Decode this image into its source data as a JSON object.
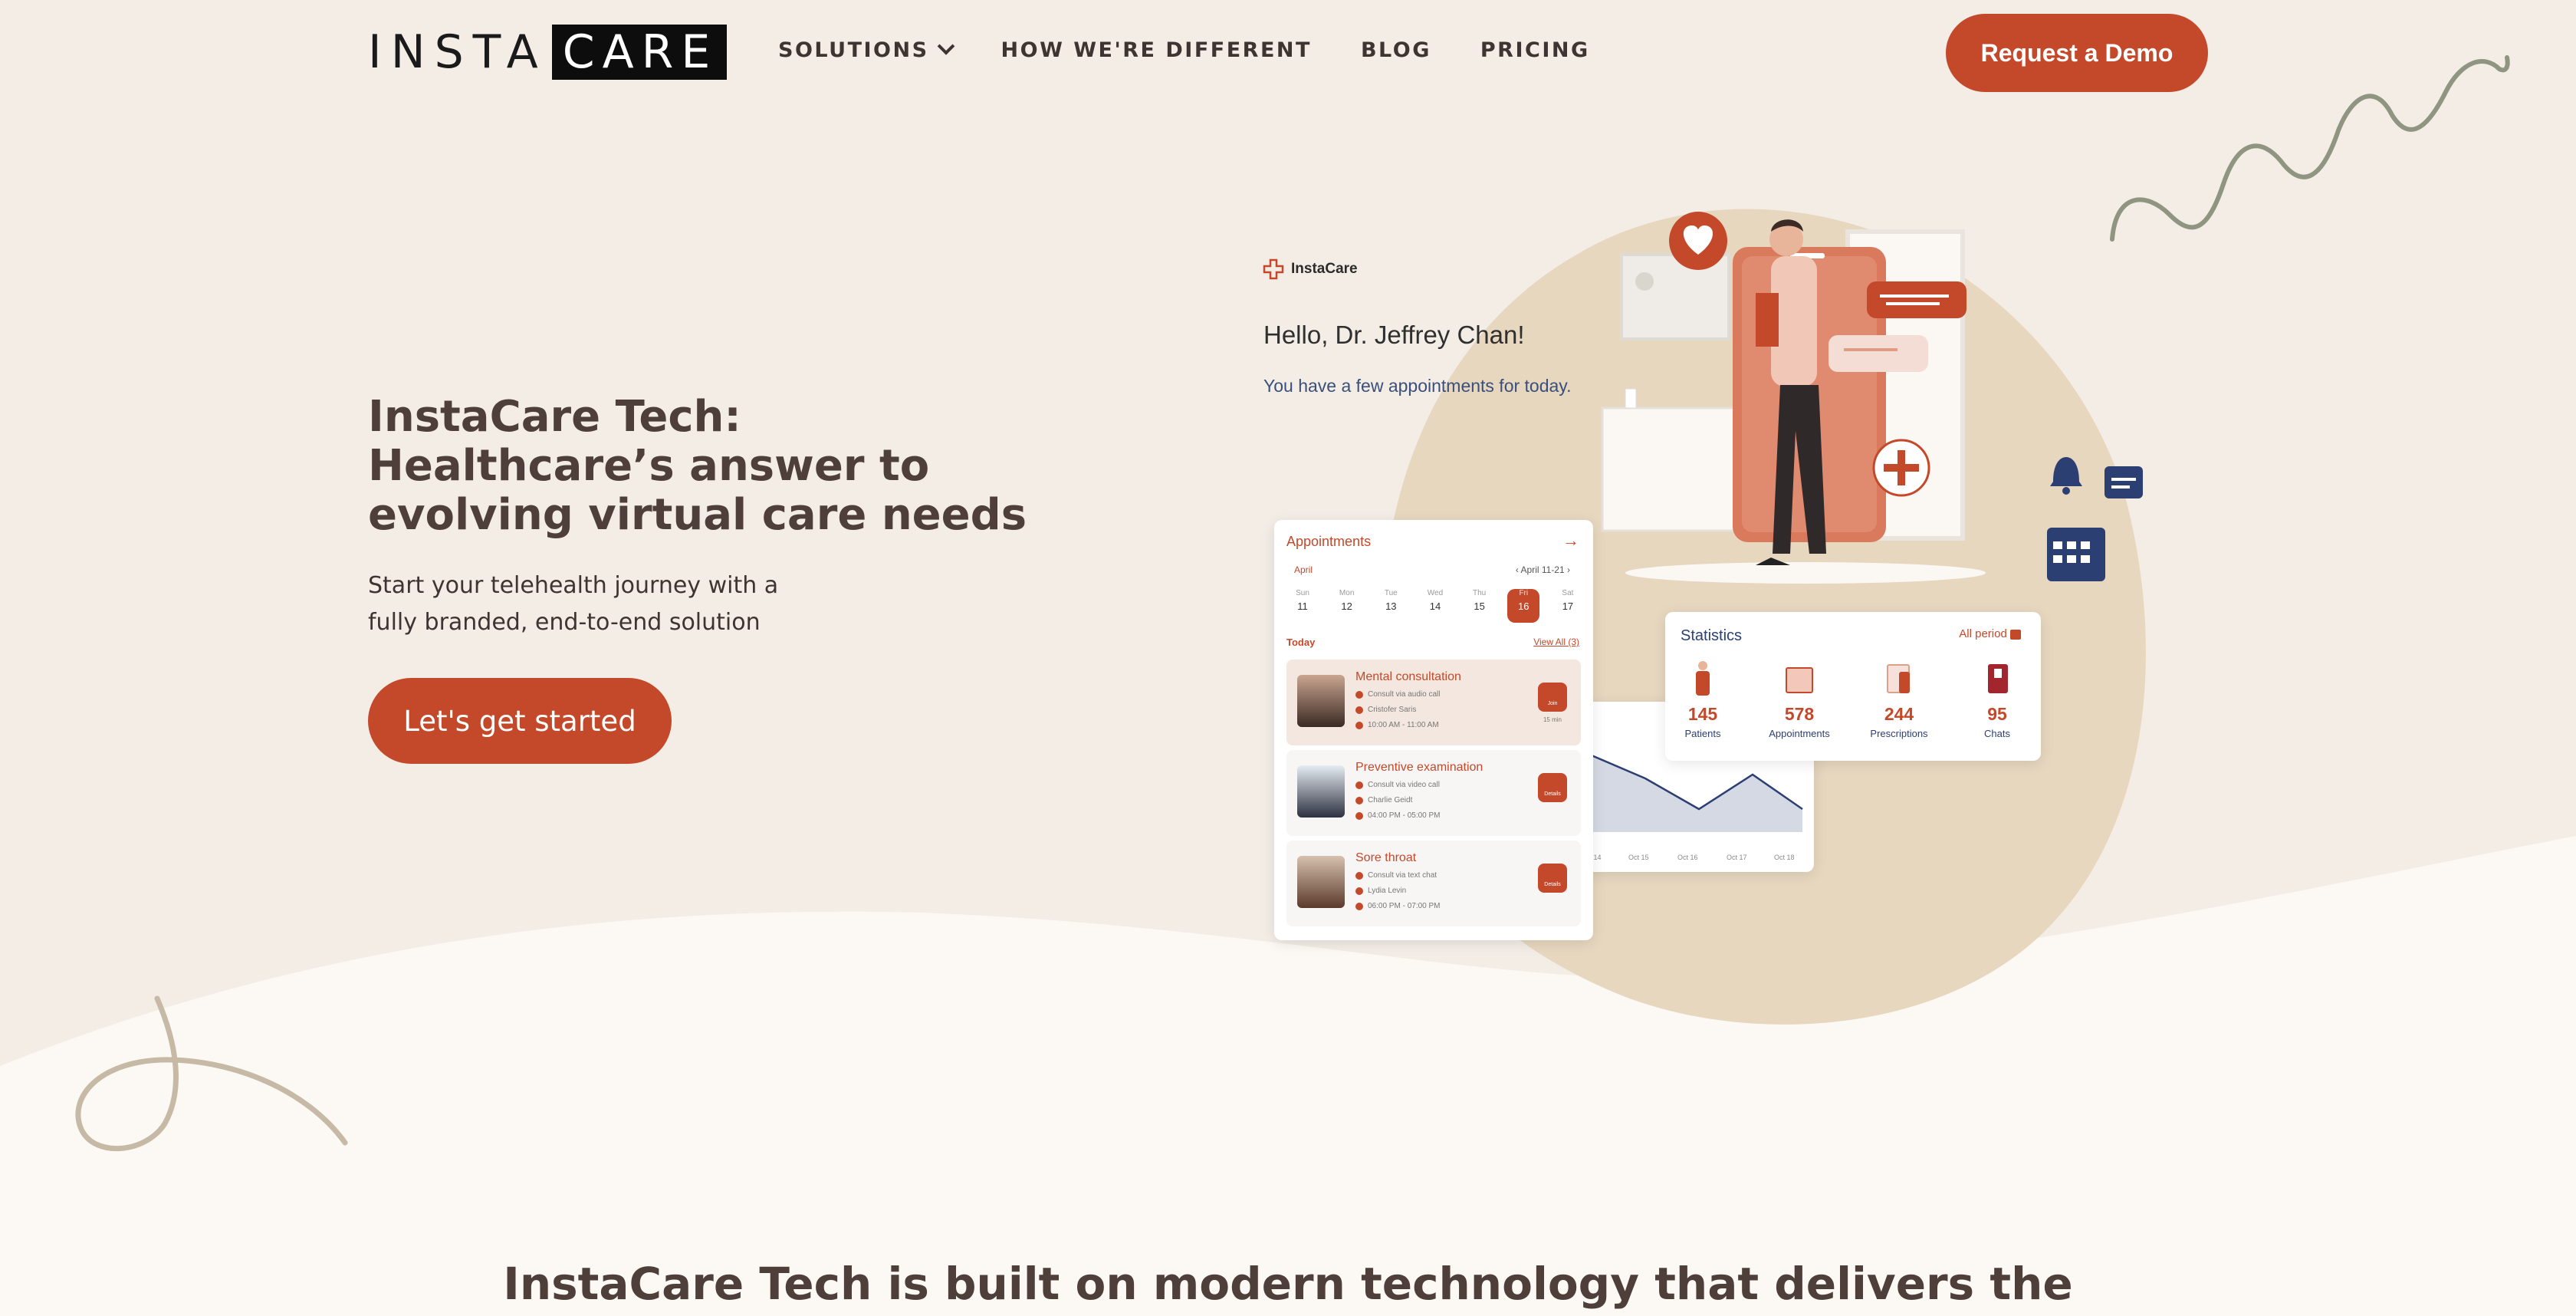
{
  "nav": {
    "logo_left": "INSTA",
    "logo_right": "CARE",
    "items": [
      {
        "label": "SOLUTIONS",
        "has_dropdown": true
      },
      {
        "label": "HOW WE'RE DIFFERENT"
      },
      {
        "label": "BLOG"
      },
      {
        "label": "PRICING"
      }
    ],
    "cta": "Request a Demo"
  },
  "hero": {
    "title": "InstaCare Tech: Healthcare’s answer to evolving virtual care needs",
    "subtitle": "Start your telehealth journey with a fully branded, end-to-end solution",
    "cta": "Let's get started"
  },
  "illustration": {
    "brand": "InstaCare",
    "greeting": "Hello, Dr. Jeffrey Chan!",
    "greeting_sub": "You have a few appointments for today.",
    "appointments": {
      "title": "Appointments",
      "month": "April",
      "range": "April 11-21",
      "days": [
        {
          "d": "Sun",
          "n": "11"
        },
        {
          "d": "Mon",
          "n": "12"
        },
        {
          "d": "Tue",
          "n": "13"
        },
        {
          "d": "Wed",
          "n": "14"
        },
        {
          "d": "Thu",
          "n": "15"
        },
        {
          "d": "Fri",
          "n": "16",
          "selected": true
        },
        {
          "d": "Sat",
          "n": "17"
        }
      ],
      "today_label": "Today",
      "view_all": "View All (3)",
      "items": [
        {
          "title": "Mental consultation",
          "mode": "Consult via audio call",
          "patient": "Cristofer Saris",
          "time": "10:00 AM - 11:00 AM",
          "action": "Join",
          "note": "15 min"
        },
        {
          "title": "Preventive examination",
          "mode": "Consult via video call",
          "patient": "Charlie Geidt",
          "time": "04:00 PM - 05:00 PM",
          "action": "Details"
        },
        {
          "title": "Sore throat",
          "mode": "Consult via text chat",
          "patient": "Lydia Levin",
          "time": "06:00 PM - 07:00 PM",
          "action": "Details"
        }
      ]
    },
    "statistics": {
      "title": "Statistics",
      "period": "All period",
      "items": [
        {
          "value": "145",
          "label": "Patients"
        },
        {
          "value": "578",
          "label": "Appointments"
        },
        {
          "value": "244",
          "label": "Prescriptions"
        },
        {
          "value": "95",
          "label": "Chats"
        }
      ]
    },
    "graph": {
      "x_labels": [
        "Oct 14",
        "Oct 15",
        "Oct 16",
        "Oct 17",
        "Oct 18"
      ]
    }
  },
  "section": {
    "title": "InstaCare Tech is built on modern technology that delivers the"
  },
  "colors": {
    "background": "#f3ede6",
    "accent": "#c4492a",
    "navy": "#2c3f73",
    "blob": "#e7d7bf"
  }
}
